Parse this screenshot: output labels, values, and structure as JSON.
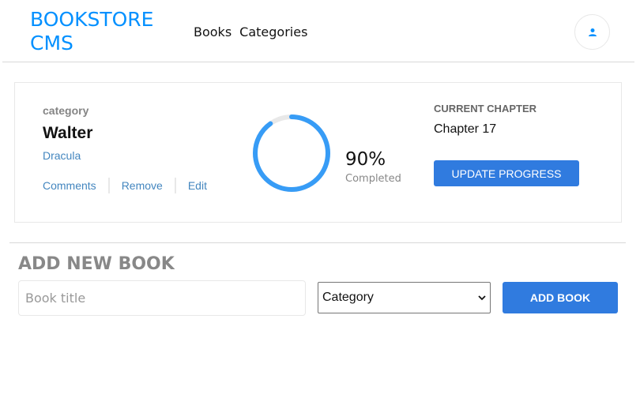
{
  "header": {
    "logo": "BOOKSTORE CMS",
    "nav": [
      "Books",
      "Categories"
    ],
    "user_icon": "user-icon"
  },
  "book": {
    "category": "category",
    "title": "Walter",
    "author": "Dracula",
    "actions": [
      "Comments",
      "Remove",
      "Edit"
    ],
    "progress": {
      "percent_text": "90%",
      "label": "Completed",
      "value": 0.9,
      "color": "#379cf6"
    },
    "current_chapter_label": "CURRENT CHAPTER",
    "current_chapter": "Chapter 17",
    "update_label": "UPDATE PROGRESS"
  },
  "form": {
    "title": "ADD NEW BOOK",
    "title_placeholder": "Book title",
    "category_selected": "Category",
    "add_label": "ADD BOOK"
  },
  "colors": {
    "brand": "#0290ff",
    "button": "#307bdf",
    "link": "#4386bf"
  }
}
